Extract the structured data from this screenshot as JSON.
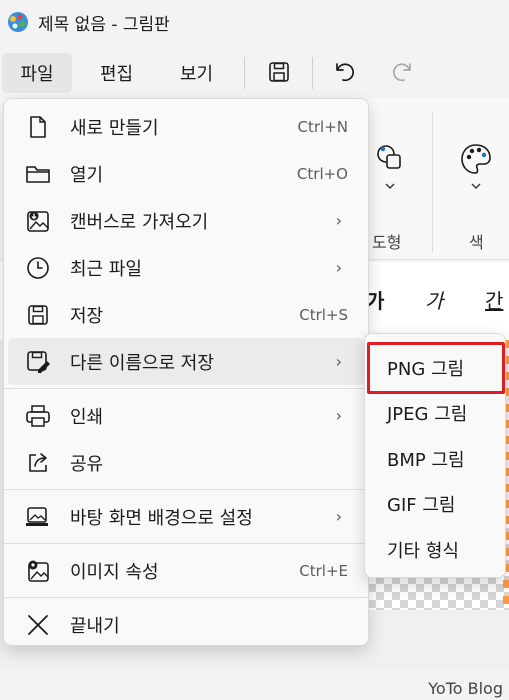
{
  "window": {
    "title": "제목 없음 - 그림판"
  },
  "menubar": {
    "file": "파일",
    "edit": "편집",
    "view": "보기"
  },
  "toolbar": {
    "save_icon": "save-icon",
    "undo_icon": "undo-icon",
    "redo_icon": "redo-icon"
  },
  "ribbon": {
    "shapes_label": "도형",
    "colors_label": "색"
  },
  "text_styles": {
    "bold": "가",
    "italic": "가",
    "underline": "간"
  },
  "file_menu": {
    "items": [
      {
        "label": "새로 만들기",
        "shortcut": "Ctrl+N",
        "icon": "new-file-icon"
      },
      {
        "label": "열기",
        "shortcut": "Ctrl+O",
        "icon": "folder-icon"
      },
      {
        "label": "캔버스로 가져오기",
        "arrow": "›",
        "icon": "import-image-icon"
      },
      {
        "label": "최근 파일",
        "arrow": "›",
        "icon": "clock-icon"
      },
      {
        "label": "저장",
        "shortcut": "Ctrl+S",
        "icon": "save-icon"
      },
      {
        "label": "다른 이름으로 저장",
        "arrow": "›",
        "icon": "save-as-icon"
      },
      {
        "label": "인쇄",
        "arrow": "›",
        "icon": "printer-icon"
      },
      {
        "label": "공유",
        "icon": "share-icon"
      },
      {
        "label": "바탕 화면 배경으로 설정",
        "arrow": "›",
        "icon": "wallpaper-icon"
      },
      {
        "label": "이미지 속성",
        "shortcut": "Ctrl+E",
        "icon": "image-properties-icon"
      },
      {
        "label": "끝내기",
        "icon": "close-icon"
      }
    ]
  },
  "save_as_submenu": {
    "items": [
      "PNG 그림",
      "JPEG 그림",
      "BMP 그림",
      "GIF 그림",
      "기타 형식"
    ],
    "highlight_color": "#e01b24"
  },
  "watermark": "YoTo Blog"
}
